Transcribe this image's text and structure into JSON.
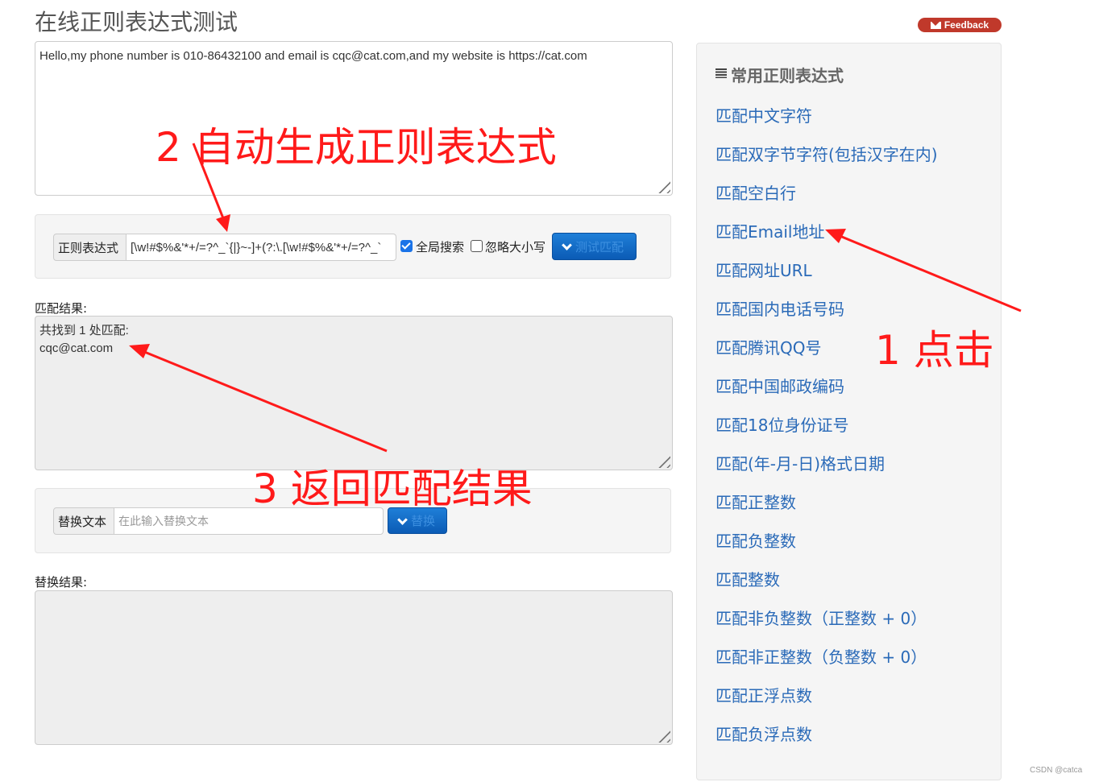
{
  "page": {
    "title": "在线正则表达式测试",
    "feedback_label": "Feedback"
  },
  "source_text": "Hello,my phone number is 010-86432100 and email is cqc@cat.com,and my website is https://cat.com",
  "regex_bar": {
    "label": "正则表达式",
    "value": "[\\w!#$%&'*+/=?^_`{|}~-]+(?:\\.[\\w!#$%&'*+/=?^_`",
    "global_search": {
      "label": "全局搜索",
      "checked": true
    },
    "ignore_case": {
      "label": "忽略大小写",
      "checked": false
    },
    "test_button": "测试匹配"
  },
  "match_result": {
    "label": "匹配结果:",
    "lines": [
      "共找到 1 处匹配:",
      "cqc@cat.com"
    ]
  },
  "replace_bar": {
    "label": "替换文本",
    "placeholder": "在此输入替换文本",
    "value": "",
    "button": "替换"
  },
  "replace_result": {
    "label": "替换结果:",
    "content": ""
  },
  "sidebar": {
    "title": "常用正则表达式",
    "items": [
      "匹配中文字符",
      "匹配双字节字符(包括汉字在内)",
      "匹配空白行",
      "匹配Email地址",
      "匹配网址URL",
      "匹配国内电话号码",
      "匹配腾讯QQ号",
      "匹配中国邮政编码",
      "匹配18位身份证号",
      "匹配(年-月-日)格式日期",
      "匹配正整数",
      "匹配负整数",
      "匹配整数",
      "匹配非负整数（正整数 + 0）",
      "匹配非正整数（负整数 + 0）",
      "匹配正浮点数",
      "匹配负浮点数"
    ]
  },
  "annotations": {
    "step1": "1 点击",
    "step2": "2 自动生成正则表达式",
    "step3": "3 返回匹配结果"
  },
  "watermark": "CSDN @catca",
  "colors": {
    "annotation": "#ff1a1a",
    "link": "#2a6ab8",
    "primary_button": "#0b5bb5",
    "feedback": "#c0392b"
  }
}
